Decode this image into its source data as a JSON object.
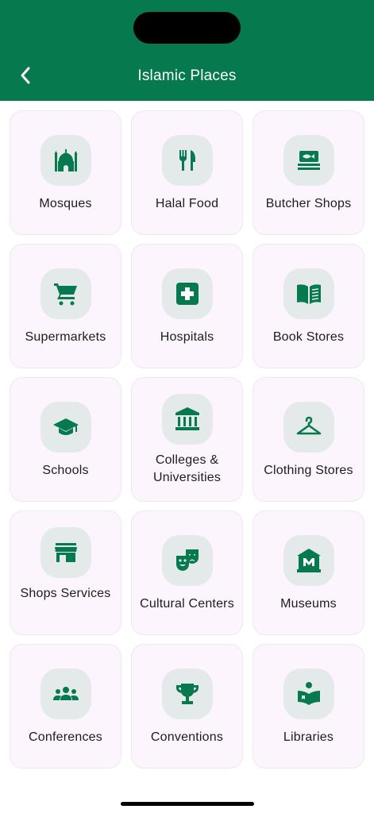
{
  "header": {
    "title": "Islamic Places",
    "back_icon": "chevron-left-icon"
  },
  "theme": {
    "primary": "#067a4e",
    "card_bg": "#fdf5fd",
    "icon_bg": "#e4eaea"
  },
  "categories": [
    {
      "label": "Mosques",
      "icon": "mosque-icon"
    },
    {
      "label": "Halal Food",
      "icon": "fork-knife-icon"
    },
    {
      "label": "Butcher Shops",
      "icon": "fish-shop-icon"
    },
    {
      "label": "Supermarkets",
      "icon": "shopping-cart-icon"
    },
    {
      "label": "Hospitals",
      "icon": "medical-cross-icon"
    },
    {
      "label": "Book Stores",
      "icon": "open-book-icon"
    },
    {
      "label": "Schools",
      "icon": "graduation-cap-icon"
    },
    {
      "label": "Colleges & Universities",
      "icon": "institution-icon"
    },
    {
      "label": "Clothing Stores",
      "icon": "hanger-icon"
    },
    {
      "label": "Shops Services",
      "icon": "storefront-icon"
    },
    {
      "label": "Cultural Centers",
      "icon": "theater-masks-icon"
    },
    {
      "label": "Museums",
      "icon": "museum-icon"
    },
    {
      "label": "Conferences",
      "icon": "group-icon"
    },
    {
      "label": "Conventions",
      "icon": "trophy-icon"
    },
    {
      "label": "Libraries",
      "icon": "reading-book-icon"
    }
  ]
}
